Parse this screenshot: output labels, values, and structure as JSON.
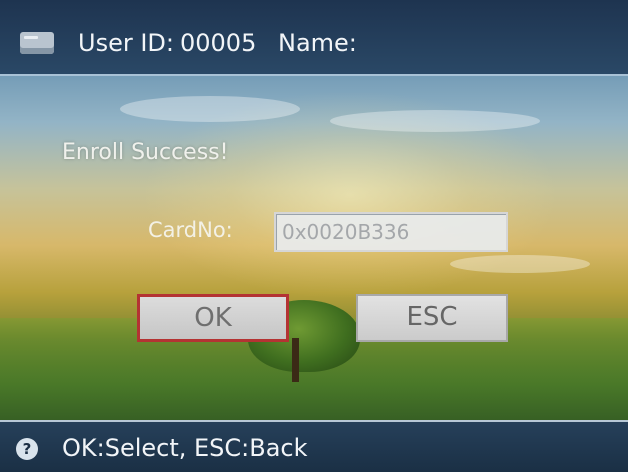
{
  "header": {
    "user_id_label": "User ID:",
    "user_id_value": "00005",
    "name_label": "Name:",
    "name_value": ""
  },
  "dialog": {
    "message": "Enroll Success!",
    "card_label": "CardNo:",
    "card_value": "0x0020B336",
    "ok_label": "OK",
    "esc_label": "ESC"
  },
  "status_bar": {
    "icon": "help-icon",
    "text": "OK:Select, ESC:Back"
  },
  "colors": {
    "title_bar": "#1e3450",
    "ok_focus_border": "#b43333",
    "button_bg": "#d2d2d2"
  }
}
